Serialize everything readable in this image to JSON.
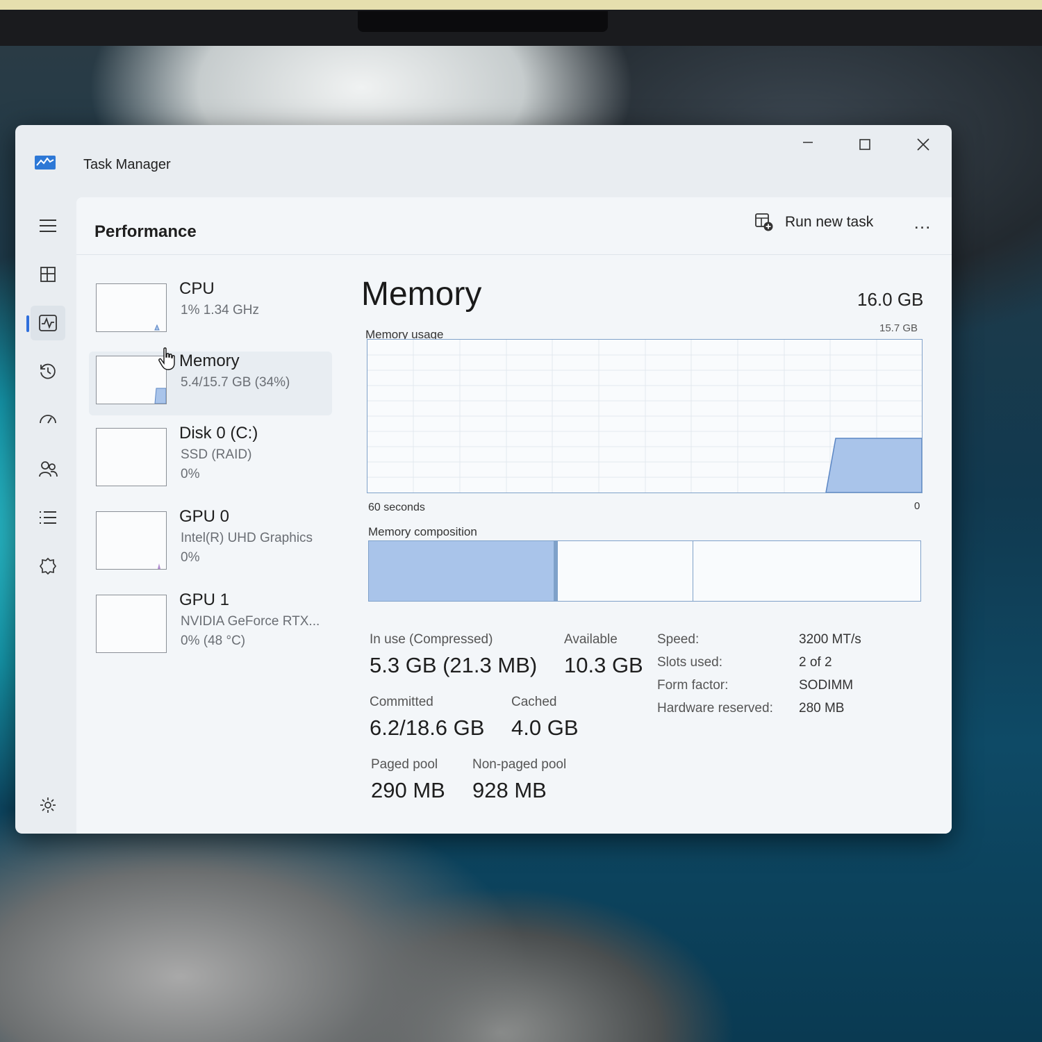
{
  "window": {
    "title": "Task Manager"
  },
  "page": {
    "title": "Performance"
  },
  "toolbar": {
    "run_new_task": "Run new task",
    "more": "…"
  },
  "nav": [
    "menu-icon",
    "processes-icon",
    "performance-icon",
    "app-history-icon",
    "startup-apps-icon",
    "users-icon",
    "details-icon",
    "services-icon",
    "settings-icon"
  ],
  "devices": [
    {
      "name": "CPU",
      "line1": "1%  1.34 GHz",
      "line2": ""
    },
    {
      "name": "Memory",
      "line1": "5.4/15.7 GB (34%)",
      "line2": ""
    },
    {
      "name": "Disk 0 (C:)",
      "line1": "SSD (RAID)",
      "line2": "0%"
    },
    {
      "name": "GPU 0",
      "line1": "Intel(R) UHD Graphics",
      "line2": "0%"
    },
    {
      "name": "GPU 1",
      "line1": "NVIDIA GeForce RTX...",
      "line2": "0%  (48 °C)"
    }
  ],
  "memory": {
    "title": "Memory",
    "total": "16.0 GB",
    "usage_label": "Memory usage",
    "usage_max": "15.7 GB",
    "axis_left": "60 seconds",
    "axis_right": "0",
    "composition_label": "Memory composition",
    "in_use_label": "In use (Compressed)",
    "in_use_value": "5.3 GB (21.3 MB)",
    "available_label": "Available",
    "available_value": "10.3 GB",
    "committed_label": "Committed",
    "committed_value": "6.2/18.6 GB",
    "cached_label": "Cached",
    "cached_value": "4.0 GB",
    "paged_label": "Paged pool",
    "paged_value": "290 MB",
    "nonpaged_label": "Non-paged pool",
    "nonpaged_value": "928 MB",
    "specs": [
      {
        "label": "Speed:",
        "value": "3200 MT/s"
      },
      {
        "label": "Slots used:",
        "value": "2 of 2"
      },
      {
        "label": "Form factor:",
        "value": "SODIMM"
      },
      {
        "label": "Hardware reserved:",
        "value": "280 MB"
      }
    ]
  },
  "colors": {
    "accent": "#2f6fdc",
    "graph_fill": "#a9c4ea",
    "graph_line": "#7fa1c9"
  }
}
